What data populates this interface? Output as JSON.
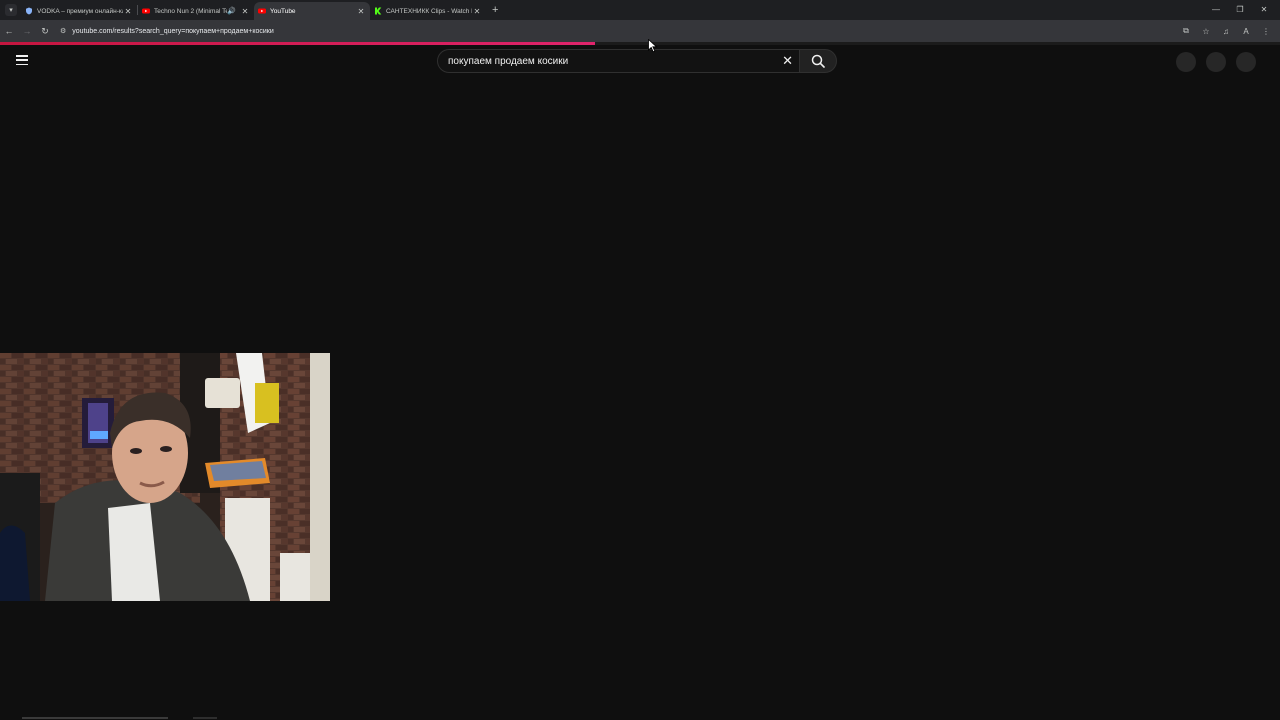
{
  "browser": {
    "tabs": [
      {
        "title": "VODKA – премиум онлайн-ка",
        "favicon": "shield-icon",
        "active": false
      },
      {
        "title": "Techno Nun 2 (Minimal Tec",
        "favicon": "youtube-icon",
        "active": false,
        "audio": true
      },
      {
        "title": "YouTube",
        "favicon": "youtube-icon",
        "active": true
      },
      {
        "title": "САНТЕХНИКК Clips - Watch Li",
        "favicon": "kick-icon",
        "active": false
      }
    ],
    "url": "youtube.com/results?search_query=покупаем+продаем+косики",
    "page_load_progress": 0.465
  },
  "youtube": {
    "search": {
      "value": "покупаем продаем косики"
    },
    "colors": {
      "background": "#0f0f0f",
      "progress": "#e0246c"
    }
  }
}
